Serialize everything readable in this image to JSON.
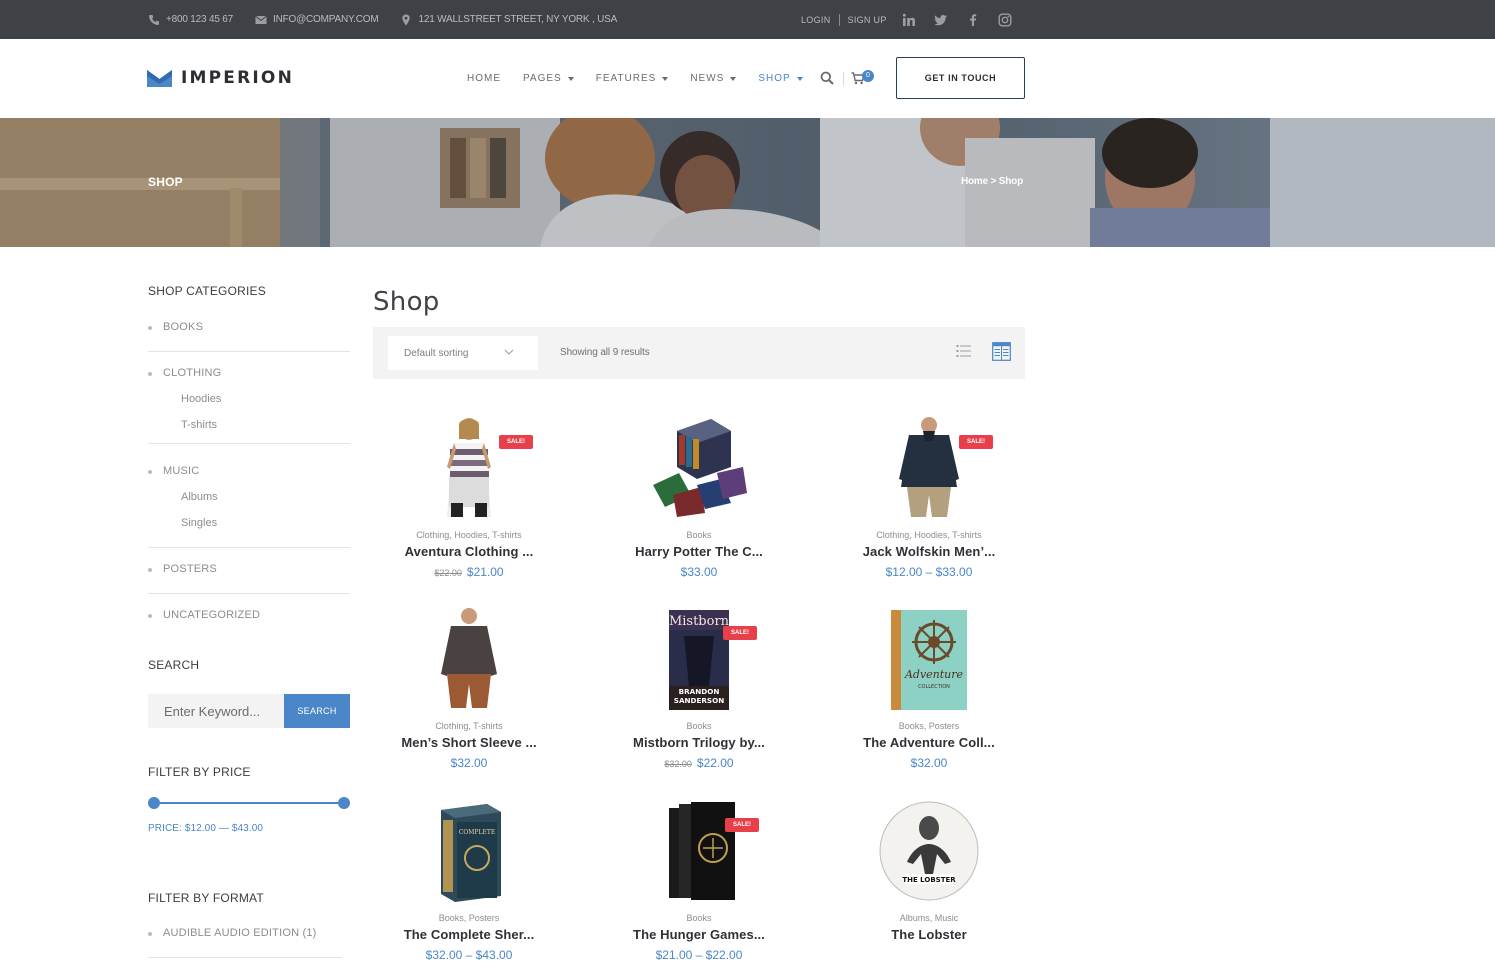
{
  "topbar": {
    "phone": "+800 123 45 67",
    "email": "INFO@COMPANY.COM",
    "address": "121 WALLSTREET STREET, NY YORK , USA",
    "login": "LOGIN",
    "signup": "SIGN UP",
    "social": [
      "linkedin-icon",
      "twitter-icon",
      "facebook-icon",
      "instagram-icon"
    ]
  },
  "header": {
    "logo_text": "IMPERION",
    "nav": [
      {
        "label": "HOME"
      },
      {
        "label": "PAGES"
      },
      {
        "label": "FEATURES"
      },
      {
        "label": "NEWS"
      },
      {
        "label": "SHOP"
      }
    ],
    "active_nav": "SHOP",
    "cart_count": "0",
    "cta_label": "GET IN TOUCH"
  },
  "hero": {
    "title": "SHOP",
    "breadcrumb": "Home > Shop"
  },
  "sidebar": {
    "categories_title": "SHOP CATEGORIES",
    "categories": [
      {
        "label": "BOOKS",
        "children": []
      },
      {
        "label": "CLOTHING",
        "children": [
          "Hoodies",
          "T-shirts"
        ]
      },
      {
        "label": "MUSIC",
        "children": [
          "Albums",
          "Singles"
        ]
      },
      {
        "label": "POSTERS",
        "children": []
      },
      {
        "label": "UNCATEGORIZED",
        "children": []
      }
    ],
    "search_title": "SEARCH",
    "search_placeholder": "Enter Keyword...",
    "search_button": "SEARCH",
    "price_title": "FILTER BY PRICE",
    "price_label": "PRICE: $12.00 — $43.00",
    "price_range": {
      "min": 12.0,
      "max": 43.0
    },
    "format_title": "FILTER BY FORMAT",
    "formats": [
      "AUDIBLE AUDIO EDITION (1)"
    ]
  },
  "main": {
    "heading": "Shop",
    "sorting": "Default sorting",
    "results_text": "Showing all 9 results",
    "view_modes": [
      "list-view-icon",
      "grid-view-icon"
    ],
    "active_view": "grid-view-icon"
  },
  "sale_label": "SALE!",
  "products": [
    {
      "name": "Aventura Clothing ...",
      "categories": "Clothing, Hoodies, T-shirts",
      "old_price": "$22.00",
      "price": "$21.00",
      "sale": true,
      "image": "striped-shirt-woman"
    },
    {
      "name": "Harry Potter The C...",
      "categories": "Books",
      "old_price": "",
      "price": "$33.00",
      "sale": false,
      "image": "book-box-set"
    },
    {
      "name": "Jack Wolfskin Men’...",
      "categories": "Clothing, Hoodies, T-shirts",
      "old_price": "",
      "price": "$12.00 – $33.00",
      "sale": true,
      "image": "dark-fleece-man"
    },
    {
      "name": "Men’s Short Sleeve ...",
      "categories": "Clothing, T-shirts",
      "old_price": "",
      "price": "$32.00",
      "sale": false,
      "image": "brown-sweater-man"
    },
    {
      "name": "Mistborn Trilogy by...",
      "categories": "Books",
      "old_price": "$32.00",
      "price": "$22.00",
      "sale": true,
      "image": "mistborn-book",
      "cover_title": "Mistborn",
      "cover_author": "BRANDON SANDERSON"
    },
    {
      "name": "The Adventure Coll...",
      "categories": "Books, Posters",
      "old_price": "",
      "price": "$32.00",
      "sale": false,
      "image": "adventure-book",
      "cover_title": "The Adventure Collection"
    },
    {
      "name": "The Complete Sher...",
      "categories": "Books, Posters",
      "old_price": "",
      "price": "$32.00 – $43.00",
      "sale": false,
      "image": "sherlock-box"
    },
    {
      "name": "The Hunger Games...",
      "categories": "Books",
      "old_price": "",
      "price": "$21.00 – $22.00",
      "sale": true,
      "image": "hunger-games-books"
    },
    {
      "name": "The Lobster",
      "categories": "Albums, Music",
      "old_price": "",
      "price": "",
      "sale": false,
      "image": "lobster-cd",
      "cover_title": "THE LOBSTER"
    }
  ]
}
